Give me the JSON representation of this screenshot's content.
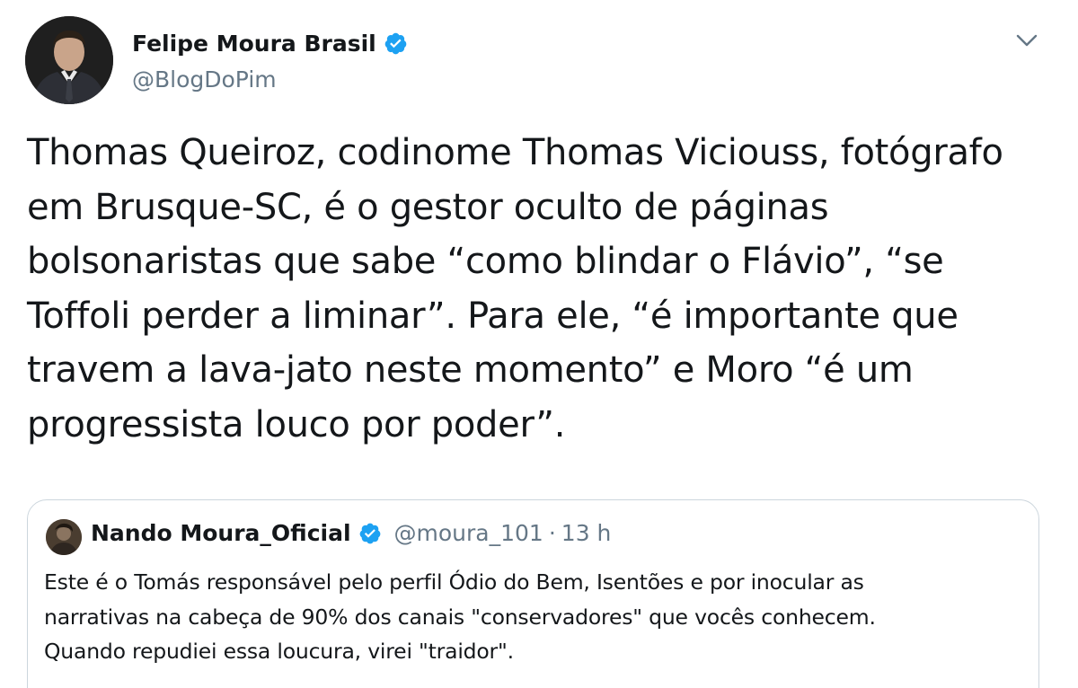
{
  "tweet": {
    "author_name": "Felipe Moura Brasil",
    "author_handle": "@BlogDoPim",
    "verified_icon": "verified-badge-icon",
    "menu_icon": "chevron-down-icon",
    "text_lines": [
      "Thomas Queiroz, codinome Thomas Viciouss, fotógrafo",
      "em Brusque-SC, é o gestor oculto de páginas",
      "bolsonaristas que sabe “como blindar o Flávio”, “se",
      "Toffoli perder a liminar”. Para ele, “é importante que",
      "travem a lava-jato neste momento” e Moro “é um",
      "progressista louco por poder”."
    ]
  },
  "quoted_tweet": {
    "author_name": "Nando Moura_Oficial",
    "author_handle": "@moura_101",
    "separator": "·",
    "time": "13 h",
    "text_lines": [
      "Este é o Tomás responsável pelo perfil Ódio do Bem, Isentões e por inocular as",
      "narrativas na cabeça de 90% dos canais \"conservadores\" que vocês conhecem.",
      "Quando repudiei essa loucura, virei \"traidor\"."
    ]
  },
  "colors": {
    "verified_blue": "#1da1f2",
    "secondary_text": "#657786",
    "border": "#ccd6dd",
    "primary_text": "#14171a"
  }
}
